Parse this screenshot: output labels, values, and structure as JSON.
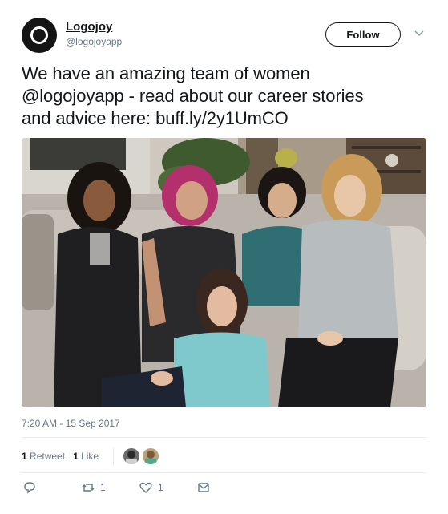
{
  "account": {
    "display_name": "Logojoy",
    "handle": "@logojoyapp"
  },
  "follow_button": {
    "label": "Follow"
  },
  "tweet": {
    "text_line1": "We have an amazing team of women",
    "text_mention": "@logojoyapp",
    "text_line2_rest": " - read about our career stories",
    "text_line3_prefix": "and advice here: ",
    "text_link": "buff.ly/2y1UmCO"
  },
  "timestamp": "7:20 AM - 15 Sep 2017",
  "stats": {
    "retweets_count": "1",
    "retweets_label": "Retweet",
    "likes_count": "1",
    "likes_label": "Like"
  },
  "actions": {
    "reply_icon": "reply-icon",
    "retweet_icon": "retweet-icon",
    "retweet_count": "1",
    "like_icon": "heart-icon",
    "like_count": "1",
    "dm_icon": "envelope-icon"
  },
  "colors": {
    "text_primary": "#14171a",
    "text_secondary": "#657786",
    "divider": "#e6ecf0",
    "avatar_bg": "#151515"
  }
}
